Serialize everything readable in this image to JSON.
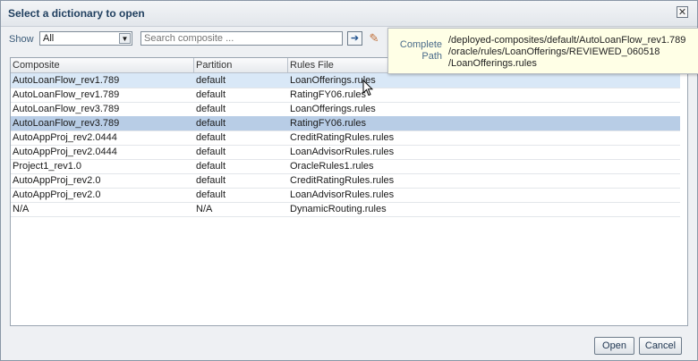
{
  "dialog": {
    "title": "Select a dictionary to open",
    "close_glyph": "✕"
  },
  "toolbar": {
    "show_label": "Show",
    "show_value": "All",
    "search_placeholder": "Search composite ...",
    "go_glyph": "➔",
    "clear_glyph": "✎"
  },
  "table": {
    "columns": [
      "Composite",
      "Partition",
      "Rules File"
    ],
    "rows": [
      {
        "composite": "AutoLoanFlow_rev1.789",
        "partition": "default",
        "rules_file": "LoanOfferings.rules"
      },
      {
        "composite": "AutoLoanFlow_rev1.789",
        "partition": "default",
        "rules_file": "RatingFY06.rules"
      },
      {
        "composite": "AutoLoanFlow_rev3.789",
        "partition": "default",
        "rules_file": "LoanOfferings.rules"
      },
      {
        "composite": "AutoLoanFlow_rev3.789",
        "partition": "default",
        "rules_file": "RatingFY06.rules"
      },
      {
        "composite": "AutoAppProj_rev2.0444",
        "partition": "default",
        "rules_file": "CreditRatingRules.rules"
      },
      {
        "composite": "AutoAppProj_rev2.0444",
        "partition": "default",
        "rules_file": "LoanAdvisorRules.rules"
      },
      {
        "composite": "Project1_rev1.0",
        "partition": "default",
        "rules_file": "OracleRules1.rules"
      },
      {
        "composite": "AutoAppProj_rev2.0",
        "partition": "default",
        "rules_file": "CreditRatingRules.rules"
      },
      {
        "composite": "AutoAppProj_rev2.0",
        "partition": "default",
        "rules_file": "LoanAdvisorRules.rules"
      },
      {
        "composite": "N/A",
        "partition": "N/A",
        "rules_file": "DynamicRouting.rules"
      }
    ]
  },
  "tooltip": {
    "label_line1": "Complete",
    "label_line2": "Path",
    "value_line1": "/deployed-composites/default/AutoLoanFlow_rev1.789",
    "value_line2": "/oracle/rules/LoanOfferings/REVIEWED_060518",
    "value_line3": "/LoanOfferings.rules"
  },
  "buttons": {
    "open": "Open",
    "cancel": "Cancel"
  }
}
